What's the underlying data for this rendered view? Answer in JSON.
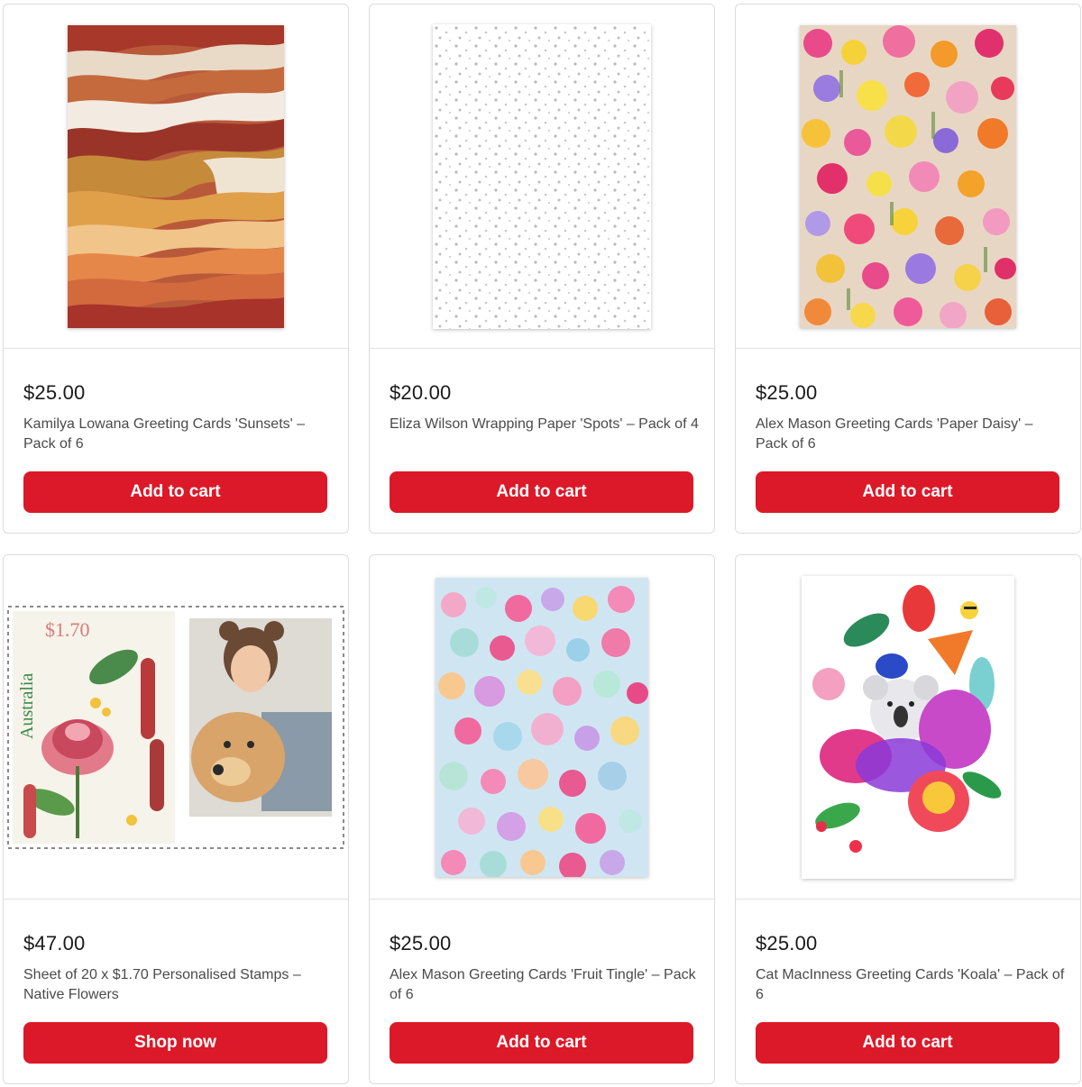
{
  "products": [
    {
      "price": "$25.00",
      "title": "Kamilya Lowana Greeting Cards 'Sunsets' – Pack of 6",
      "cta": "Add to cart",
      "image": "sunsets-card-artwork"
    },
    {
      "price": "$20.00",
      "title": "Eliza Wilson Wrapping Paper 'Spots' – Pack of 4",
      "cta": "Add to cart",
      "image": "spots-wrapping-paper"
    },
    {
      "price": "$25.00",
      "title": "Alex Mason Greeting Cards 'Paper Daisy' – Pack of 6",
      "cta": "Add to cart",
      "image": "paper-daisy-card-artwork"
    },
    {
      "price": "$47.00",
      "title": "Sheet of 20 x $1.70 Personalised Stamps – Native Flowers",
      "cta": "Shop now",
      "image": "personalised-stamp",
      "stamp": {
        "value": "$1.70",
        "country": "Australia"
      }
    },
    {
      "price": "$25.00",
      "title": "Alex Mason Greeting Cards 'Fruit Tingle' – Pack of 6",
      "cta": "Add to cart",
      "image": "fruit-tingle-card-artwork"
    },
    {
      "price": "$25.00",
      "title": "Cat MacInness Greeting Cards 'Koala' – Pack of 6",
      "cta": "Add to cart",
      "image": "koala-card-artwork"
    }
  ],
  "colors": {
    "accent": "#dc1928",
    "border": "#dcdcdc",
    "price_text": "#1a1a1a",
    "title_text": "#4a4a4a"
  }
}
